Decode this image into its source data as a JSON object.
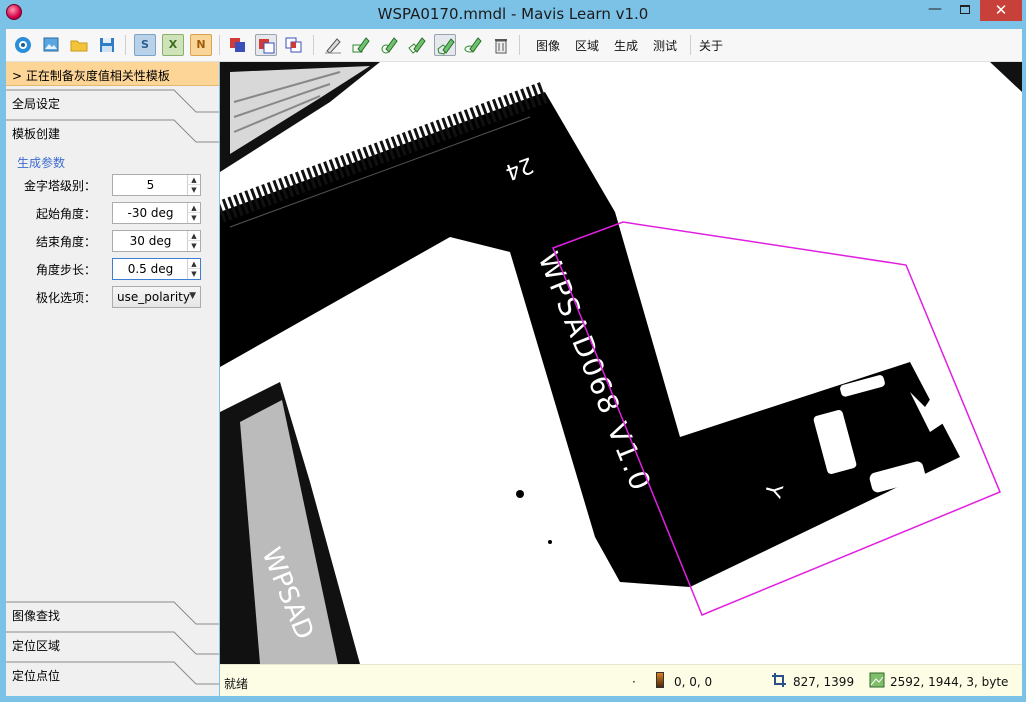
{
  "window": {
    "title": "WSPA0170.mmdl - Mavis Learn v1.0",
    "min_glyph": "—",
    "close_glyph": "✕"
  },
  "toolbar": {
    "letters": {
      "s": "S",
      "x": "X",
      "n": "N"
    },
    "menus": [
      "图像",
      "区域",
      "生成",
      "测试",
      "关于"
    ]
  },
  "sidebar": {
    "active_section": "> 正在制备灰度值相关性模板",
    "sections": [
      "全局设定",
      "模板创建",
      "图像查找",
      "定位区域",
      "定位点位"
    ],
    "group_title": "生成参数",
    "params": [
      {
        "label": "金字塔级别：",
        "value": "5"
      },
      {
        "label": "起始角度：",
        "value": "-30 deg"
      },
      {
        "label": "结束角度：",
        "value": "30 deg"
      },
      {
        "label": "角度步长：",
        "value": "0.5 deg"
      },
      {
        "label": "极化选项：",
        "value": "use_polarity"
      }
    ]
  },
  "canvas": {
    "labels": {
      "pin_count": "24",
      "part_number": "WPSAD068 V1.0",
      "marker": "Y",
      "part_number_2": "WPSAD"
    },
    "roi_color": "#e020e0"
  },
  "status": {
    "text": "就绪",
    "dot": "·",
    "pixel_value": "0, 0, 0",
    "cursor_pos": "827, 1399",
    "image_info": "2592, 1944, 3, byte"
  },
  "colors": {
    "title_bar": "#7cc2e7",
    "active_section": "#fdd597",
    "group_title": "#3d6bd1",
    "close_button": "#c7413a"
  }
}
